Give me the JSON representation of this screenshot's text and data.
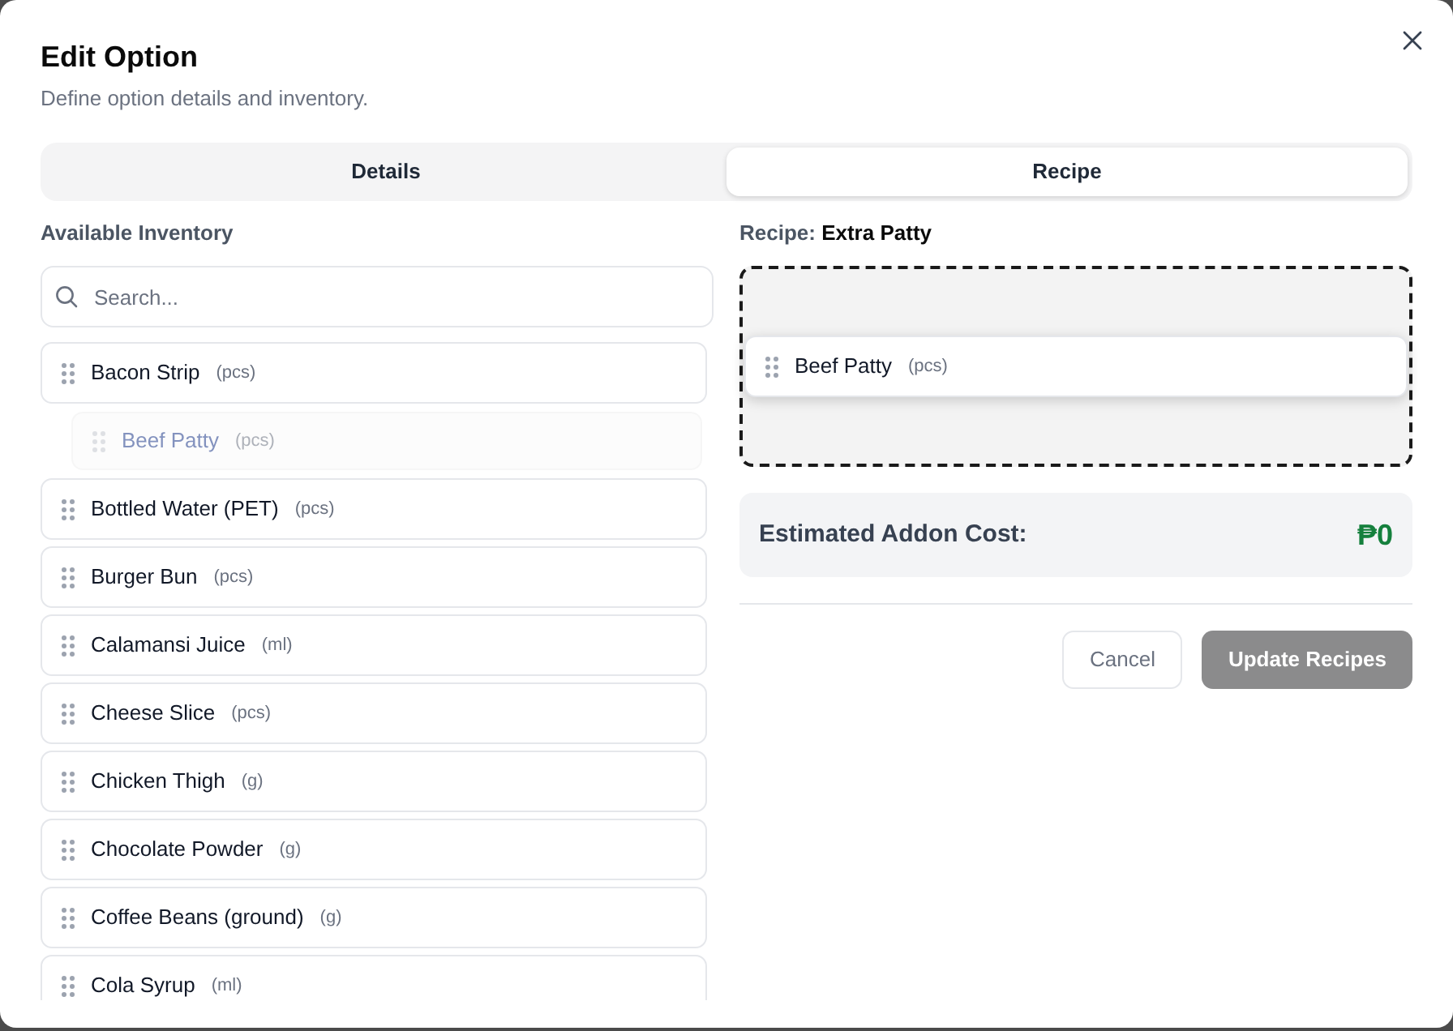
{
  "dialog": {
    "title": "Edit Option",
    "subtitle": "Define option details and inventory."
  },
  "tabs": [
    {
      "label": "Details",
      "selected": false
    },
    {
      "label": "Recipe",
      "selected": true
    }
  ],
  "inventory": {
    "heading": "Available Inventory",
    "search": {
      "placeholder": "Search..."
    },
    "items": [
      {
        "name": "Bacon Strip",
        "unit": "(pcs)",
        "kind": "item"
      },
      {
        "name": "Beef Patty",
        "unit": "(pcs)",
        "kind": "placeholder"
      },
      {
        "name": "Bottled Water (PET)",
        "unit": "(pcs)",
        "kind": "item"
      },
      {
        "name": "Burger Bun",
        "unit": "(pcs)",
        "kind": "item"
      },
      {
        "name": "Calamansi Juice",
        "unit": "(ml)",
        "kind": "item"
      },
      {
        "name": "Cheese Slice",
        "unit": "(pcs)",
        "kind": "item"
      },
      {
        "name": "Chicken Thigh",
        "unit": "(g)",
        "kind": "item"
      },
      {
        "name": "Chocolate Powder",
        "unit": "(g)",
        "kind": "item"
      },
      {
        "name": "Coffee Beans (ground)",
        "unit": "(g)",
        "kind": "item"
      },
      {
        "name": "Cola Syrup",
        "unit": "(ml)",
        "kind": "item"
      }
    ]
  },
  "recipe": {
    "heading": "Recipe: **Extra Patty**",
    "items": [
      {
        "name": "Beef Patty",
        "unit": "(pcs)"
      }
    ]
  },
  "cost": {
    "label": "Estimated Addon Cost:",
    "value": "₱0"
  },
  "buttons": [
    {
      "label": "Cancel",
      "kind": "secondary",
      "disabled": false
    },
    {
      "label": "Update Recipes",
      "kind": "primary",
      "disabled": true
    }
  ]
}
